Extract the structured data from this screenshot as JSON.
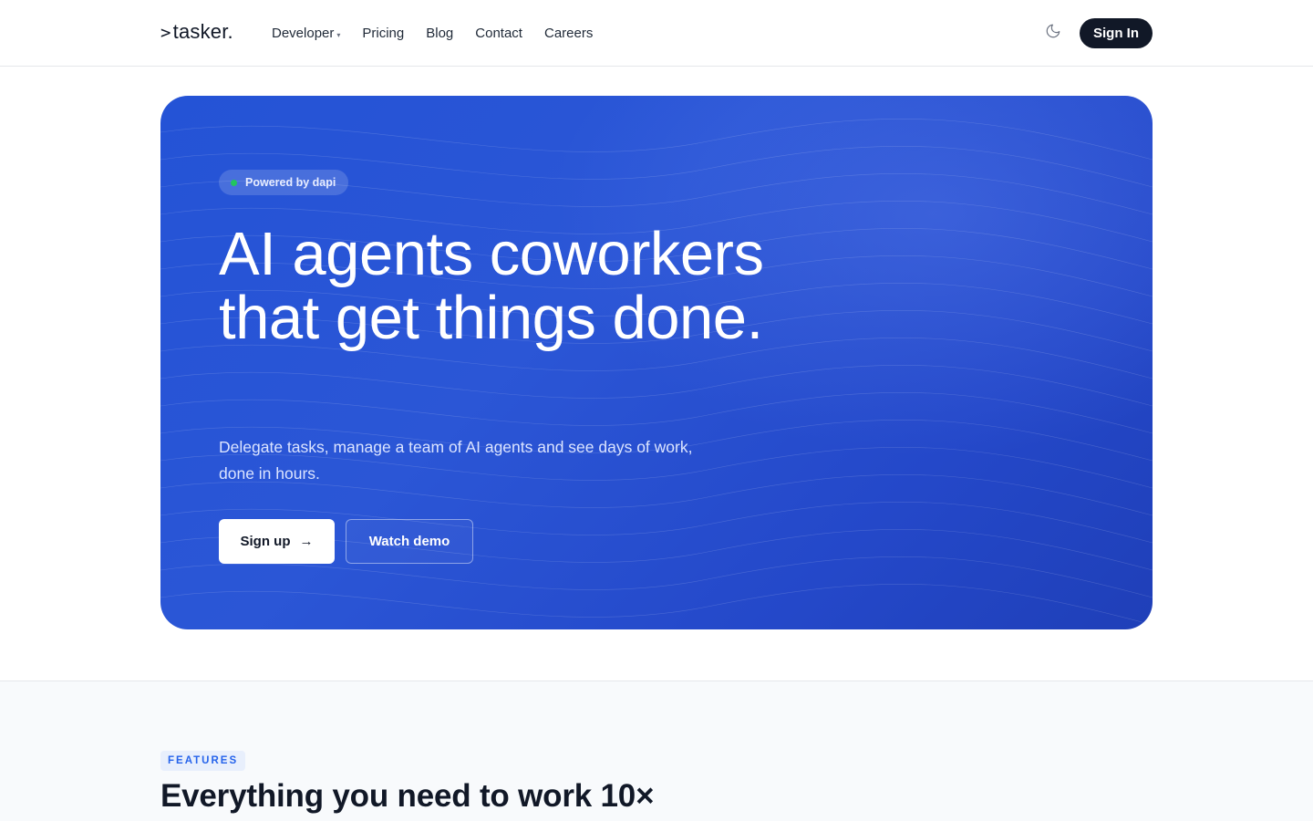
{
  "nav": {
    "logo_caret": ">",
    "logo_text": "tasker.",
    "links": [
      {
        "label": "Developer",
        "has_dropdown": true,
        "dropdown_icon": "▾"
      },
      {
        "label": "Pricing"
      },
      {
        "label": "Blog"
      },
      {
        "label": "Contact"
      },
      {
        "label": "Careers"
      }
    ],
    "theme_icon": "moon-icon",
    "signin_label": "Sign In"
  },
  "hero": {
    "badge": "Powered by dapi",
    "badge_dot_color": "#22c55e",
    "title": "AI agents coworkers that get things done.",
    "subtitle": "Delegate tasks, manage a team of AI agents and see days of work, done in hours.",
    "primary_cta": "Sign up",
    "primary_icon": "→",
    "secondary_cta": "Watch demo",
    "background_color": "#2453d6"
  },
  "features": {
    "tag": "FEATURES",
    "title": "Everything you need to work 10×",
    "accent_color": "#2563eb"
  }
}
